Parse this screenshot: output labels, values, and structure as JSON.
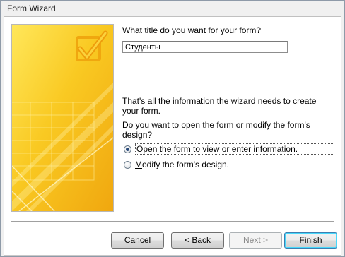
{
  "window": {
    "title": "Form Wizard"
  },
  "wizard": {
    "title_question": "What title do you want for your form?",
    "title_value": "Студенты",
    "info_text": "That's all the information the wizard needs to create your form.",
    "open_question": "Do you want to open the form or modify the form's design?",
    "options": [
      {
        "mnemonic": "O",
        "rest": "pen the form to view or enter information.",
        "selected": true
      },
      {
        "mnemonic": "M",
        "rest": "odify the form's design.",
        "selected": false
      }
    ]
  },
  "buttons": {
    "cancel": {
      "pre": "",
      "mnemonic": "",
      "rest": "Cancel"
    },
    "back": {
      "pre": "< ",
      "mnemonic": "B",
      "rest": "ack"
    },
    "next": {
      "pre": "",
      "mnemonic": "",
      "rest": "Next >"
    },
    "finish": {
      "pre": "",
      "mnemonic": "F",
      "rest": "inish"
    }
  },
  "colors": {
    "art_yellow_light": "#ffe14a",
    "art_yellow": "#f8c21a",
    "art_orange": "#efa70e",
    "finish_border": "#3c7fb1"
  }
}
